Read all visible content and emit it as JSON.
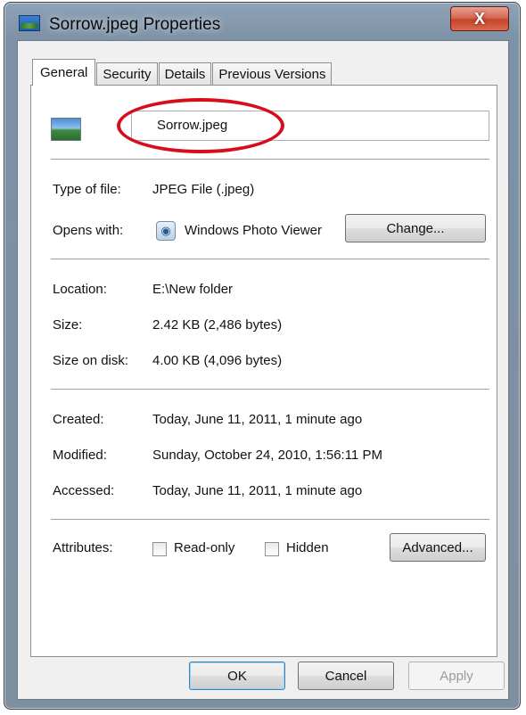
{
  "window": {
    "title": "Sorrow.jpeg Properties",
    "close_label": "X"
  },
  "tabs": [
    {
      "label": "General",
      "active": true
    },
    {
      "label": "Security"
    },
    {
      "label": "Details"
    },
    {
      "label": "Previous Versions"
    }
  ],
  "general": {
    "file_name": "Sorrow.jpeg",
    "type_label": "Type of file:",
    "type_value": "JPEG File (.jpeg)",
    "opens_label": "Opens with:",
    "opens_value": "Windows Photo Viewer",
    "change_button": "Change...",
    "location_label": "Location:",
    "location_value": "E:\\New folder",
    "size_label": "Size:",
    "size_value": "2.42 KB (2,486 bytes)",
    "size_disk_label": "Size on disk:",
    "size_disk_value": "4.00 KB (4,096 bytes)",
    "created_label": "Created:",
    "created_value": "Today, June 11, 2011, 1 minute ago",
    "modified_label": "Modified:",
    "modified_value": "Sunday, October 24, 2010, 1:56:11 PM",
    "accessed_label": "Accessed:",
    "accessed_value": "Today, June 11, 2011, 1 minute ago",
    "attributes_label": "Attributes:",
    "readonly_label": "Read-only",
    "hidden_label": "Hidden",
    "advanced_button": "Advanced..."
  },
  "footer": {
    "ok": "OK",
    "cancel": "Cancel",
    "apply": "Apply"
  },
  "colors": {
    "annotation": "#d80d1c",
    "close_button": "#c5442c"
  }
}
